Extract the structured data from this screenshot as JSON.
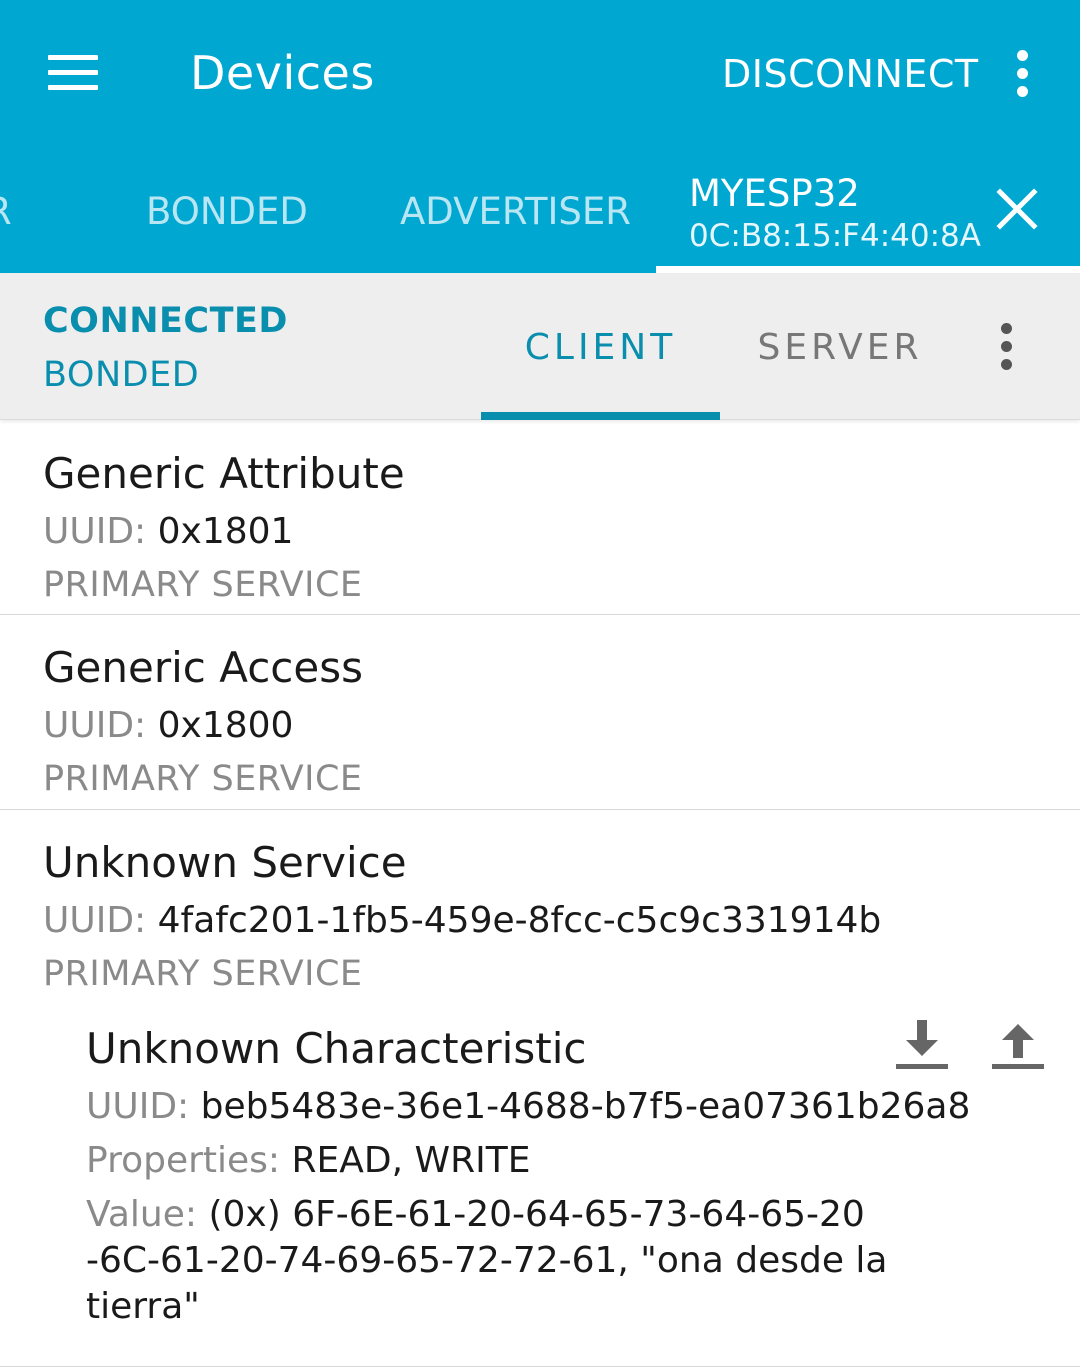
{
  "appbar": {
    "title": "Devices",
    "disconnect_label": "DISCONNECT",
    "menu_icon": "hamburger-menu",
    "overflow_icon": "more-vert",
    "background": "#00A7D1"
  },
  "device_tabs": {
    "partial_label": "R",
    "bonded_label": "BONDED",
    "advertiser_label": "ADVERTISER",
    "device": {
      "name": "MYESP32",
      "address": "0C:B8:15:F4:40:8A"
    },
    "close_icon": "close-x"
  },
  "connection": {
    "status": "CONNECTED",
    "bond_state": "BONDED",
    "tabs": [
      "CLIENT",
      "SERVER"
    ],
    "active_tab": "CLIENT",
    "accent": "#0A8EAE"
  },
  "services": [
    {
      "name": "Generic Attribute",
      "uuid_label": "UUID:",
      "uuid": "0x1801",
      "type": "PRIMARY SERVICE"
    },
    {
      "name": "Generic Access",
      "uuid_label": "UUID:",
      "uuid": "0x1800",
      "type": "PRIMARY SERVICE"
    },
    {
      "name": "Unknown Service",
      "uuid_label": "UUID:",
      "uuid": "4fafc201-1fb5-459e-8fcc-c5c9c331914b",
      "type": "PRIMARY SERVICE",
      "characteristic": {
        "name": "Unknown Characteristic",
        "uuid_label": "UUID:",
        "uuid": "beb5483e-36e1-4688-b7f5-ea07361b26a8",
        "properties_label": "Properties:",
        "properties": "READ, WRITE",
        "value_label": "Value:",
        "value_line1": "(0x) 6F-6E-61-20-64-65-73-64-65-20",
        "value_line2": "-6C-61-20-74-69-65-72-72-61, \"ona desde la",
        "value_line3": "tierra\"",
        "read_icon": "download-arrow",
        "write_icon": "upload-arrow"
      }
    }
  ]
}
